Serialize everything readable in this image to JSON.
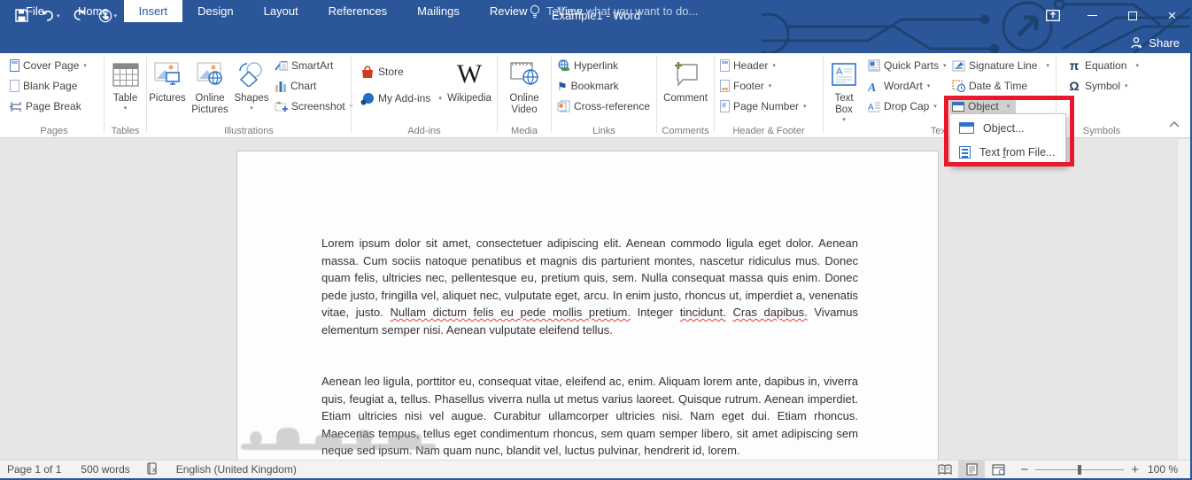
{
  "titlebar": {
    "title": "Example1 - Word",
    "qat": {
      "save": "save",
      "undo": "undo",
      "redo": "redo",
      "touch": "touch-mouse-mode",
      "customize": "customize-quick-access-toolbar"
    },
    "window": {
      "ribbon_display": "ribbon-display-options",
      "minimize": "minimize",
      "maximize": "maximize",
      "close": "close"
    }
  },
  "tabs": {
    "items": [
      {
        "label": "File"
      },
      {
        "label": "Home"
      },
      {
        "label": "Insert",
        "active": true
      },
      {
        "label": "Design"
      },
      {
        "label": "Layout"
      },
      {
        "label": "References"
      },
      {
        "label": "Mailings"
      },
      {
        "label": "Review"
      },
      {
        "label": "View"
      }
    ],
    "tell_me": "Tell me what you want to do...",
    "share": "Share"
  },
  "ribbon": {
    "groups": [
      {
        "label": "Pages",
        "items": [
          {
            "label": "Cover Page"
          },
          {
            "label": "Blank Page"
          },
          {
            "label": "Page Break"
          }
        ]
      },
      {
        "label": "Tables",
        "items": [
          {
            "label": "Table"
          }
        ]
      },
      {
        "label": "Illustrations",
        "items": [
          {
            "label": "Pictures"
          },
          {
            "label": "Online Pictures"
          },
          {
            "label": "Shapes"
          },
          {
            "label": "SmartArt"
          },
          {
            "label": "Chart"
          },
          {
            "label": "Screenshot"
          }
        ]
      },
      {
        "label": "Add-ins",
        "items": [
          {
            "label": "Store"
          },
          {
            "label": "My Add-ins"
          },
          {
            "label": "Wikipedia"
          }
        ]
      },
      {
        "label": "Media",
        "items": [
          {
            "label": "Online Video"
          }
        ]
      },
      {
        "label": "Links",
        "items": [
          {
            "label": "Hyperlink"
          },
          {
            "label": "Bookmark"
          },
          {
            "label": "Cross-reference"
          }
        ]
      },
      {
        "label": "Comments",
        "items": [
          {
            "label": "Comment"
          }
        ]
      },
      {
        "label": "Header & Footer",
        "items": [
          {
            "label": "Header"
          },
          {
            "label": "Footer"
          },
          {
            "label": "Page Number"
          }
        ]
      },
      {
        "label": "Text",
        "items": [
          {
            "label": "Text Box"
          },
          {
            "label": "Quick Parts"
          },
          {
            "label": "WordArt"
          },
          {
            "label": "Drop Cap"
          },
          {
            "label": "Signature Line"
          },
          {
            "label": "Date & Time"
          },
          {
            "label": "Object"
          }
        ]
      },
      {
        "label": "Symbols",
        "items": [
          {
            "label": "Equation"
          },
          {
            "label": "Symbol"
          }
        ]
      }
    ]
  },
  "dropdown": {
    "items": [
      {
        "pre": "Ob",
        "key": "j",
        "post": "ect..."
      },
      {
        "pre": "Text ",
        "key": "f",
        "post": "rom File..."
      }
    ]
  },
  "document": {
    "paragraphs": [
      {
        "segments": [
          {
            "text": "Lorem ipsum dolor sit amet, consectetuer adipiscing elit. Aenean commodo ligula eget dolor. Aenean massa. Cum sociis natoque penatibus et magnis dis parturient montes, nascetur ridiculus mus. Donec quam felis, ultricies nec, pellentesque eu, pretium quis, sem. Nulla consequat massa quis enim. Donec pede justo, fringilla vel, aliquet nec, vulputate eget, arcu. In enim justo, rhoncus ut, imperdiet a, venenatis vitae, justo. "
          },
          {
            "text": "Nullam dictum felis eu pede mollis pretium.",
            "spell": true
          },
          {
            "text": " Integer "
          },
          {
            "text": "tincidunt.",
            "spell": true
          },
          {
            "text": " "
          },
          {
            "text": "Cras dapibus.",
            "spell": true
          },
          {
            "text": " Vivamus elementum semper nisi. Aenean vulputate eleifend tellus."
          }
        ]
      },
      {
        "segments": [
          {
            "text": "Aenean leo ligula, porttitor eu, consequat vitae, eleifend ac, enim. Aliquam lorem ante, dapibus in, viverra quis, feugiat a, tellus. Phasellus viverra nulla ut metus varius laoreet. Quisque rutrum. Aenean imperdiet. Etiam ultricies nisi vel augue. Curabitur ullamcorper ultricies nisi. Nam eget dui. Etiam rhoncus. Maecenas tempus, tellus eget condimentum rhoncus, sem quam semper libero, sit amet adipiscing sem neque sed ipsum. Nam quam nunc, blandit vel, luctus pulvinar, hendrerit id, lorem."
          }
        ]
      }
    ]
  },
  "statusbar": {
    "page": "Page 1 of 1",
    "words": "500 words",
    "language": "English (United Kingdom)",
    "zoom_level": "100 %"
  },
  "colors": {
    "titlebar_blue": "#2b579a",
    "annotation_red": "#e8192c",
    "spellcheck_red": "#e03a3a"
  }
}
